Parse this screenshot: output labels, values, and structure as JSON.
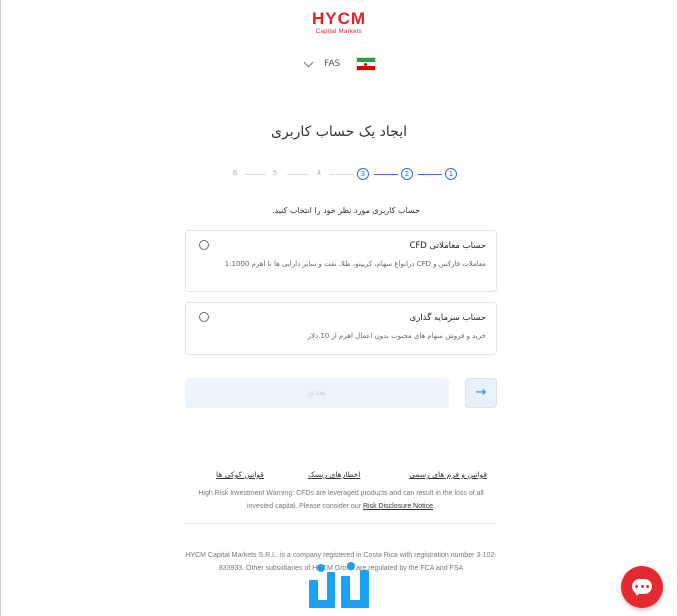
{
  "brand": {
    "name": "HYCM",
    "tagline": "Capital Markets",
    "color": "#e0202f"
  },
  "language": {
    "code": "FAS",
    "flag": "iran-flag"
  },
  "page_title": "ایجاد یک حساب کاربری",
  "steps": {
    "current": 3,
    "labels": [
      "1",
      "2",
      "3",
      "4",
      "5",
      "6"
    ]
  },
  "prompt": "حساب کاربری مورد نظر خود را انتخاب کنید.",
  "account_options": [
    {
      "title": "حساب معاملاتی CFD",
      "description": "معاملات فارکس و CFD درانواع سهام، کریپتو، طلا، نفت و سایر دارایی ها تا اهرم 1:1000",
      "selected": false
    },
    {
      "title": "حساب سرمایه گذاری",
      "description": "خرید و فروش سهام های محبوب بدون اعمال اهرم از 10 دلار",
      "selected": false
    }
  ],
  "buttons": {
    "next_label": "بعدی",
    "back_icon": "arrow-right-icon"
  },
  "footer_links": [
    "قوانین و فرم های رسمی",
    "اخطارهای ریسک",
    "قوانین کوکی ها"
  ],
  "risk_warning": {
    "text": "High Risk Investment Warning: CFDs are leveraged products and can result in the loss of all invested capital. Please consider our ",
    "link": "Risk Disclosure Notice"
  },
  "company_info": "HYCM Capital Markets S.R.L. is a company registered in Costa Rica with registration number 3-102-833933. Other subsidiaries of HYCM Group are regulated by the FCA and FSA",
  "colors": {
    "accent": "#2e6ee0",
    "chat": "#e52a2f"
  }
}
